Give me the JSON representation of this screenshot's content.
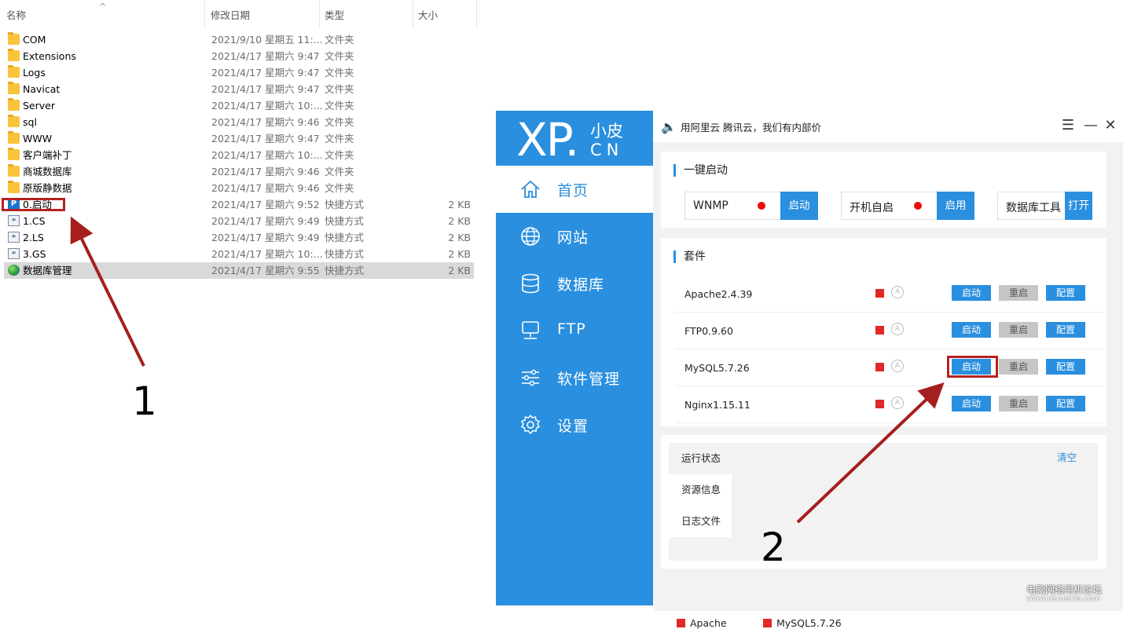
{
  "explorer": {
    "columns": {
      "name": "名称",
      "date": "修改日期",
      "type": "类型",
      "size": "大小"
    },
    "rows": [
      {
        "icon": "folder-icon",
        "name": "COM",
        "date": "2021/9/10 星期五 11:...",
        "type": "文件夹",
        "size": ""
      },
      {
        "icon": "folder-icon",
        "name": "Extensions",
        "date": "2021/4/17 星期六 9:47",
        "type": "文件夹",
        "size": ""
      },
      {
        "icon": "folder-icon",
        "name": "Logs",
        "date": "2021/4/17 星期六 9:47",
        "type": "文件夹",
        "size": ""
      },
      {
        "icon": "folder-icon",
        "name": "Navicat",
        "date": "2021/4/17 星期六 9:47",
        "type": "文件夹",
        "size": ""
      },
      {
        "icon": "folder-icon",
        "name": "Server",
        "date": "2021/4/17 星期六 10:...",
        "type": "文件夹",
        "size": ""
      },
      {
        "icon": "folder-icon",
        "name": "sql",
        "date": "2021/4/17 星期六 9:46",
        "type": "文件夹",
        "size": ""
      },
      {
        "icon": "folder-icon",
        "name": "WWW",
        "date": "2021/4/17 星期六 9:47",
        "type": "文件夹",
        "size": ""
      },
      {
        "icon": "folder-icon",
        "name": "客户端补丁",
        "date": "2021/4/17 星期六 10:...",
        "type": "文件夹",
        "size": ""
      },
      {
        "icon": "folder-icon",
        "name": "商城数据库",
        "date": "2021/4/17 星期六 9:46",
        "type": "文件夹",
        "size": ""
      },
      {
        "icon": "folder-icon",
        "name": "原版静数据",
        "date": "2021/4/17 星期六 9:46",
        "type": "文件夹",
        "size": ""
      },
      {
        "icon": "p-shortcut-icon",
        "name": "0.启动",
        "date": "2021/4/17 星期六 9:52",
        "type": "快捷方式",
        "size": "2 KB"
      },
      {
        "icon": "shortcut-icon",
        "name": "1.CS",
        "date": "2021/4/17 星期六 9:49",
        "type": "快捷方式",
        "size": "2 KB"
      },
      {
        "icon": "shortcut-icon",
        "name": "2.LS",
        "date": "2021/4/17 星期六 9:49",
        "type": "快捷方式",
        "size": "2 KB"
      },
      {
        "icon": "shortcut-icon",
        "name": "3.GS",
        "date": "2021/4/17 星期六 10:...",
        "type": "快捷方式",
        "size": "2 KB"
      },
      {
        "icon": "globe-icon",
        "name": "数据库管理",
        "date": "2021/4/17 星期六 9:55",
        "type": "快捷方式",
        "size": "2 KB"
      }
    ]
  },
  "xp": {
    "logo": {
      "main": "XP.",
      "sub1": "小皮",
      "sub2": "CN"
    },
    "notice": "用阿里云 腾讯云，我们有内部价",
    "nav": [
      {
        "label": "首页",
        "icon": "home-icon"
      },
      {
        "label": "网站",
        "icon": "globe-icon"
      },
      {
        "label": "数据库",
        "icon": "database-icon"
      },
      {
        "label": "FTP",
        "icon": "ftp-icon"
      },
      {
        "label": "软件管理",
        "icon": "sliders-icon"
      },
      {
        "label": "设置",
        "icon": "gear-icon"
      }
    ],
    "quick": {
      "title": "一键启动",
      "items": [
        {
          "label": "WNMP",
          "button": "启动"
        },
        {
          "label": "开机自启",
          "button": "启用"
        },
        {
          "label": "数据库工具",
          "button": "打开"
        }
      ]
    },
    "suite": {
      "title": "套件",
      "buttons": {
        "start": "启动",
        "restart": "重启",
        "config": "配置"
      },
      "services": [
        "Apache2.4.39",
        "FTP0.9.60",
        "MySQL5.7.26",
        "Nginx1.15.11"
      ]
    },
    "log": {
      "tabs": [
        "运行状态",
        "资源信息",
        "日志文件"
      ],
      "clear": "清空"
    },
    "statusbar": [
      "Apache",
      "MySQL5.7.26"
    ],
    "colors": {
      "accent": "#2a8fdf",
      "stopped": "#e02828",
      "highlight": "#b5221f"
    }
  },
  "annotations": {
    "one": "1",
    "two": "2"
  },
  "watermark": {
    "line1": "电脑网络用机论坛",
    "line2": "www.texuexia.com"
  }
}
